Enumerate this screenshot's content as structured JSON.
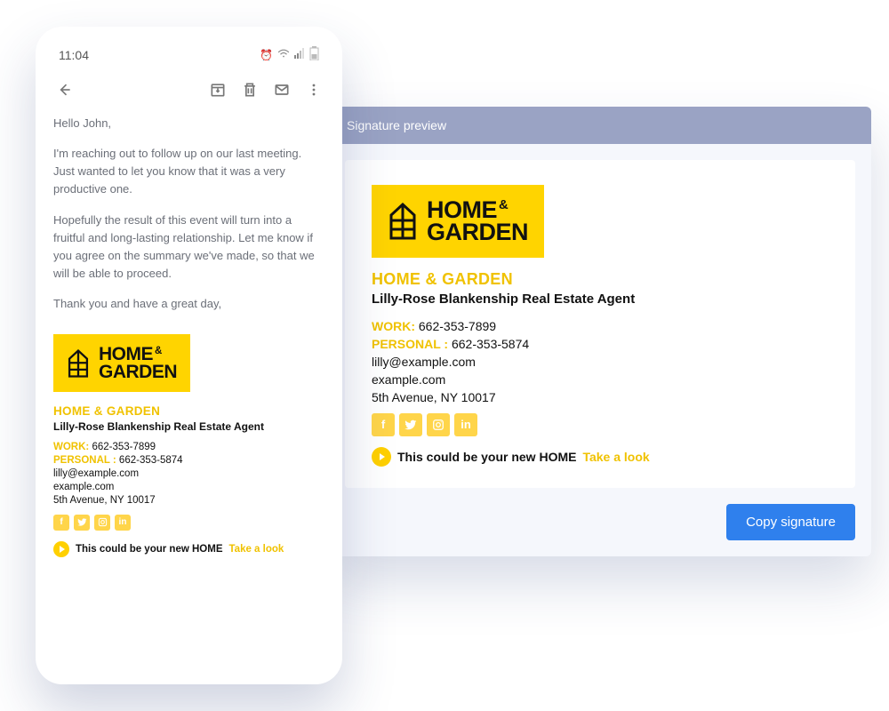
{
  "phone": {
    "time": "11:04",
    "email": {
      "greeting": "Hello John,",
      "p1": "I'm reaching out to follow up on our last meeting. Just wanted to let you know that it was a very productive one.",
      "p2": "Hopefully the result of this event will turn into a fruitful and long-lasting relationship. Let me know if you agree on the summary we've made, so that we will be able to proceed.",
      "p3": "Thank you and have a great day,"
    }
  },
  "preview": {
    "header": "Signature preview",
    "copy_button": "Copy signature"
  },
  "signature": {
    "logo_line1": "HOME",
    "logo_amp": "&",
    "logo_line2": "GARDEN",
    "company": "HOME & GARDEN",
    "name": "Lilly-Rose Blankenship Real Estate Agent",
    "work_label": "WORK:",
    "work_phone": "662-353-7899",
    "personal_label": "PERSONAL :",
    "personal_phone": "662-353-5874",
    "email": "lilly@example.com",
    "website": "example.com",
    "address": "5th Avenue, NY 10017",
    "cta_text": "This could be your new HOME",
    "cta_link": "Take a look",
    "social": {
      "facebook": "f",
      "twitter": "t",
      "instagram": "ig",
      "linkedin": "in"
    }
  }
}
